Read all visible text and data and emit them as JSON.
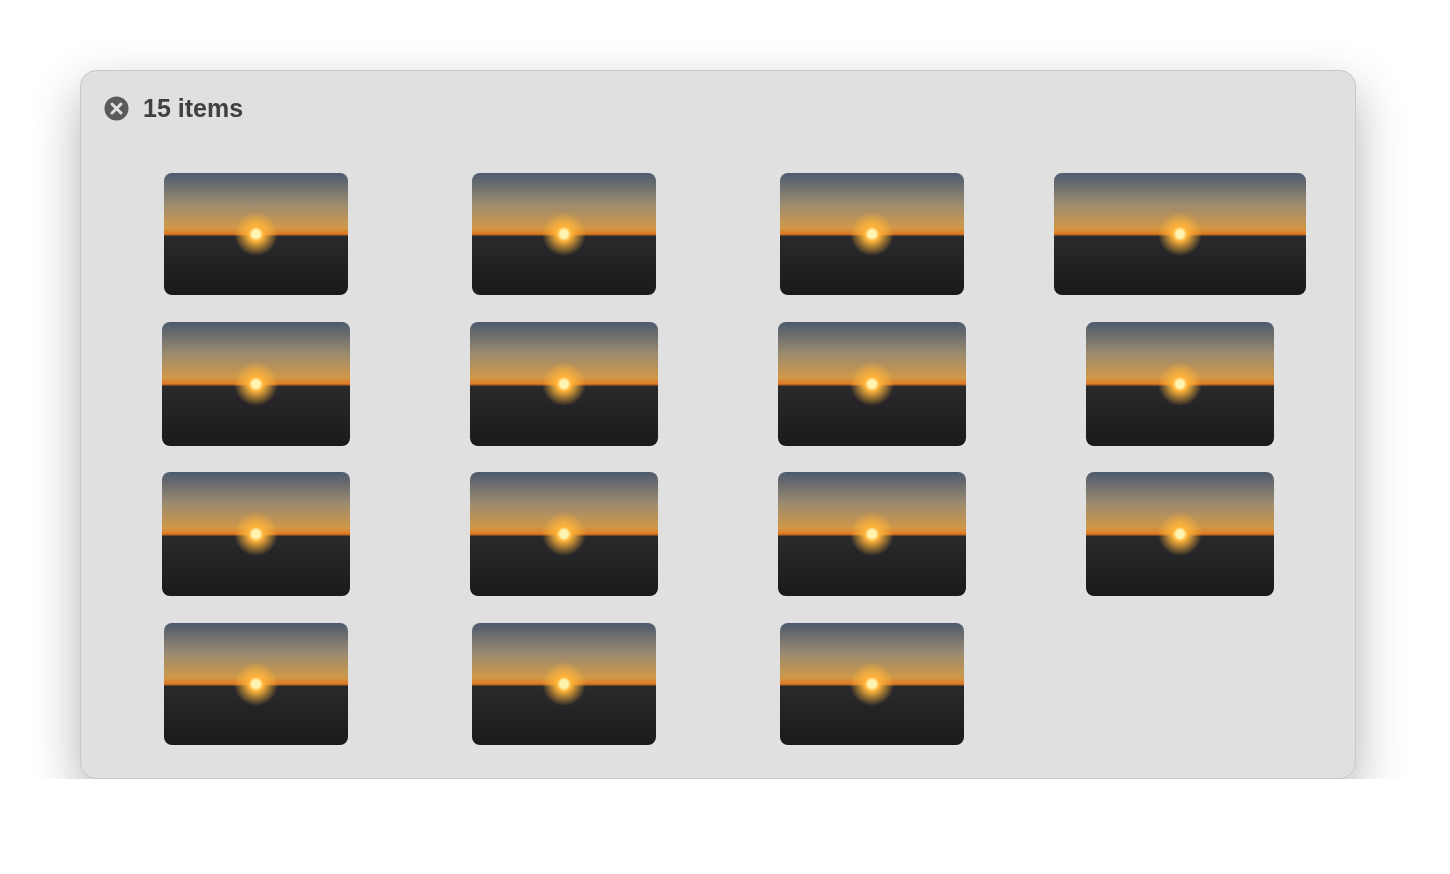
{
  "title": "15 items",
  "photos": [
    {
      "kind": "normal"
    },
    {
      "kind": "normal"
    },
    {
      "kind": "normal"
    },
    {
      "kind": "wide"
    },
    {
      "kind": "large"
    },
    {
      "kind": "large"
    },
    {
      "kind": "large"
    },
    {
      "kind": "large"
    },
    {
      "kind": "large"
    },
    {
      "kind": "large"
    },
    {
      "kind": "large"
    },
    {
      "kind": "large"
    },
    {
      "kind": "normal"
    },
    {
      "kind": "normal"
    },
    {
      "kind": "normal"
    }
  ]
}
